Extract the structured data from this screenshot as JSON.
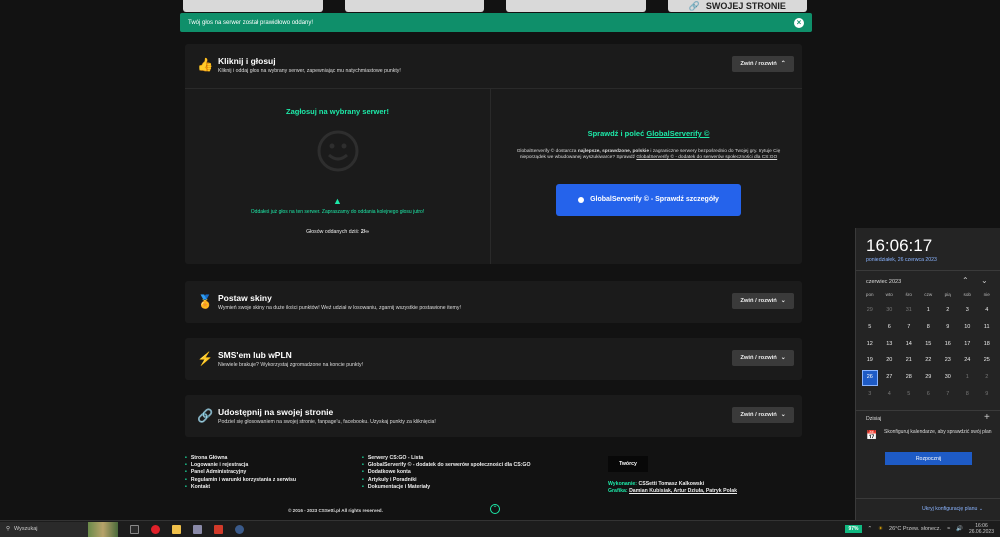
{
  "top_strip": {
    "buttons": [
      "",
      "",
      "",
      "SWOJEJ STRONIE"
    ]
  },
  "alert": {
    "text": "Twój głos na serwer został prawidłowo oddany!",
    "close": "×"
  },
  "panels": [
    {
      "title": "Kliknij i głosuj",
      "subtitle": "Kliknij i oddaj głos na wybrany serwer, zapewniając mu natychmiastowe punkty!",
      "toggle": "Zwiń / rozwiń",
      "icon": "thumbs-up-icon"
    },
    {
      "title": "Postaw skiny",
      "subtitle": "Wymień swoje skiny na duże ilości punktów! Weź udział w losowaniu, zgarnij wszystkie postawione itemy!",
      "toggle": "Zwiń / rozwiń",
      "icon": "award-icon"
    },
    {
      "title": "SMS'em lub wPLN",
      "subtitle": "Niewiele brakuje? Wykorzystaj zgromadzone na koncie punkty!",
      "toggle": "Zwiń / rozwiń",
      "icon": "bolt-icon"
    },
    {
      "title": "Udostępnij na swojej stronie",
      "subtitle": "Podziel się głosowaniem na swojej stronie, fanpage'u, facebooku. Uzyskaj punkty za kliknięcia!",
      "toggle": "Zwiń / rozwiń",
      "icon": "link-icon"
    }
  ],
  "vote": {
    "heading": "Zagłosuj na wybrany serwer!",
    "warning": "Oddałeś już głos na ten serwer. Zapraszamy do oddania kolejnego głosu jutro!",
    "count_label": "Głosów oddanych dziś:",
    "count_value": "2/∞"
  },
  "globalserverify": {
    "heading_prefix": "Sprawdź i poleć",
    "heading_link": "GlobalServerify ©",
    "desc_start": "GlobalServerify © dostarcza",
    "desc_bold": "najlepsze, sprawdzone, polskie",
    "desc_mid": "i zagraniczne serwery bezpośrednio do Twojej gry. Irytuje Cię nieporządek we wbudowanej wyszukiwarce? Sprawdź",
    "desc_link": "GlobalServerify © - dodatek do serwerów społeczności dla CS:GO",
    "button": "GlobalServerify © - Sprawdź szczegóły"
  },
  "footer": {
    "col1": [
      "Strona Główna",
      "Logowanie i rejestracja",
      "Panel Administracyjny",
      "Regulamin i warunki korzystania z serwisu",
      "Kontakt"
    ],
    "col2": [
      "Serwery CS:GO - Lista",
      "GlobalServerify © - dodatek do serwerów społeczności dla CS:GO",
      "Dodatkowe konta",
      "Artykuły i Poradniki",
      "Dokumentacje i Materiały"
    ],
    "creators_label": "Twórcy",
    "made_label": "Wykonanie:",
    "made_value": "CSSetti Tomasz Kalkowski",
    "graphics_label": "Grafika:",
    "graphics_value": "Damian Kubisiak, Artur Dziuła, Patryk Polak",
    "copyright": "© 2016 - 2023 CSSetti.pl All rights reserved."
  },
  "calendar": {
    "time": "16:06:17",
    "date": "poniedziałek, 26 czerwca 2023",
    "month": "czerwiec 2023",
    "weekdays": [
      "pon",
      "wto",
      "śro",
      "czw",
      "pią",
      "sob",
      "nie"
    ],
    "rows": [
      [
        "29",
        "30",
        "31",
        "1",
        "2",
        "3",
        "4"
      ],
      [
        "5",
        "6",
        "7",
        "8",
        "9",
        "10",
        "11"
      ],
      [
        "12",
        "13",
        "14",
        "15",
        "16",
        "17",
        "18"
      ],
      [
        "19",
        "20",
        "21",
        "22",
        "23",
        "24",
        "25"
      ],
      [
        "26",
        "27",
        "28",
        "29",
        "30",
        "1",
        "2"
      ],
      [
        "3",
        "4",
        "5",
        "6",
        "7",
        "8",
        "9"
      ]
    ],
    "today_label": "Dzisiaj",
    "event_text": "Skonfiguruj kalendarze, aby sprawdzić swój plan",
    "start_button": "Rozpocznij",
    "hide_plan": "Ukryj konfigurację planu"
  },
  "taskbar": {
    "search": "Wyszukaj",
    "battery": "97%",
    "weather": "26°C  Przew. słonecz.",
    "clock_time": "16:06",
    "clock_date": "26.06.2023"
  }
}
